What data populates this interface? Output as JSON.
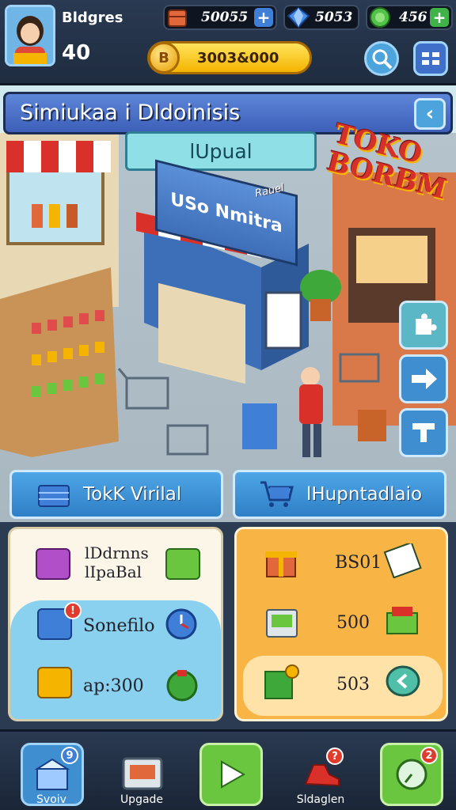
{
  "header": {
    "player_name": "Bldgres",
    "player_level": "40",
    "resources": [
      {
        "icon": "crate-icon",
        "value": "50055",
        "color": "#e0683a",
        "plus_color": "#3f7fd8"
      },
      {
        "icon": "gem-icon",
        "value": "5053",
        "color": "#3f7fd8"
      },
      {
        "icon": "green-coin-icon",
        "value": "456",
        "color": "#3fb34a",
        "plus_color": "#3fb34a"
      }
    ],
    "coins": "3003&000"
  },
  "scene": {
    "title": "Simiukaa i Dldoinisis",
    "label_panel": "lUpual",
    "shop_sign": "USo Nmitra",
    "small_label": "Rauel",
    "toko_sign_line1": "TOKO",
    "toko_sign_line2": "BORBM",
    "buttons": [
      {
        "label": "TokK Virilal"
      },
      {
        "label": "lHupntadlaio"
      }
    ]
  },
  "panels": {
    "left": {
      "title_line1": "lDdrnns",
      "title_line2": "lIpaBal",
      "row2": "Sonefilo",
      "row3": "ap:300"
    },
    "right": {
      "row1": "BS01",
      "row2": "500",
      "row3": "503"
    }
  },
  "nav": {
    "items": [
      {
        "label": "Svoiv",
        "badge": "9"
      },
      {
        "label": "Upgade",
        "badge": ""
      },
      {
        "label": "",
        "badge": ""
      },
      {
        "label": "Sldaglen",
        "badge": "?"
      },
      {
        "label": "",
        "badge": "2"
      }
    ]
  },
  "colors": {
    "accent_blue": "#3f8fd0",
    "accent_gold": "#f4b400",
    "accent_green": "#6bc63f",
    "accent_orange": "#f8b545"
  }
}
